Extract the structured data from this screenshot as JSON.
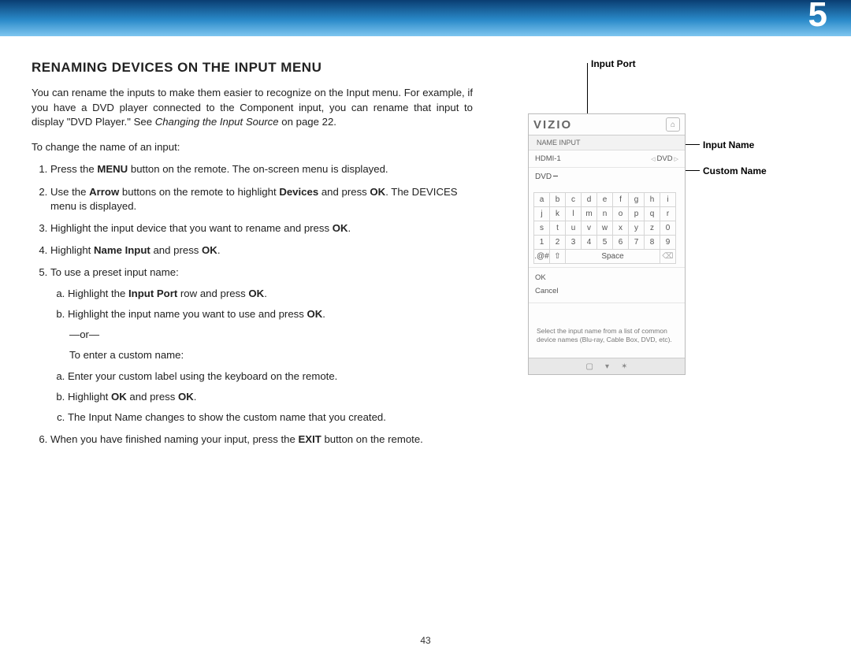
{
  "chapter": "5",
  "page_number": "43",
  "heading": "RENAMING DEVICES ON THE INPUT MENU",
  "intro_html": "You can rename the inputs to make them easier to recognize on the Input menu. For example, if you have a DVD player connected to the Component input, you can rename that input to display \"DVD Player.\" See <i>Changing the Input Source</i> on page 22.",
  "leadin": "To change the name of an input:",
  "steps": [
    "Press the <b>MENU</b> button on the remote. The on-screen menu is displayed.",
    "Use the <b>Arrow</b> buttons on the remote to highlight <b>Devices</b> and press <b>OK</b>. The DEVICES menu is displayed.",
    "Highlight the input device that you want to rename and press <b>OK</b>.",
    "Highlight <b>Name Input</b> and press <b>OK</b>."
  ],
  "step5_lead": "To use a preset input name:",
  "step5a": "Highlight the <b>Input Port</b> row and press <b>OK</b>.",
  "step5b": "Highlight the input name you want to use and press <b>OK</b>.",
  "or_text": "—or—",
  "custom_lead": "To enter a custom name:",
  "custom_a": "Enter your custom label using the keyboard on the remote.",
  "custom_b": "Highlight <b>OK</b> and press <b>OK</b>.",
  "custom_c": "The Input Name changes to show the custom name that you created.",
  "step6": "When you have finished naming your input, press the <b>EXIT</b> button on the remote.",
  "callouts": {
    "input_port": "Input Port",
    "input_name": "Input Name",
    "custom_name": "Custom Name"
  },
  "osd": {
    "logo": "VIZIO",
    "title": "NAME INPUT",
    "port_label": "HDMI-1",
    "port_value": "DVD",
    "custom_value": "DVD",
    "keyboard_rows": [
      [
        "a",
        "b",
        "c",
        "d",
        "e",
        "f",
        "g",
        "h",
        "i"
      ],
      [
        "j",
        "k",
        "l",
        "m",
        "n",
        "o",
        "p",
        "q",
        "r"
      ],
      [
        "s",
        "t",
        "u",
        "v",
        "w",
        "x",
        "y",
        "z",
        "0"
      ],
      [
        "1",
        "2",
        "3",
        "4",
        "5",
        "6",
        "7",
        "8",
        "9"
      ]
    ],
    "sym_key": ".@#",
    "shift_key": "⇧",
    "space_key": "Space",
    "backspace": "⌫",
    "ok": "OK",
    "cancel": "Cancel",
    "hint": "Select the input name from a list of common device names (Blu-ray, Cable Box, DVD, etc).",
    "footer_icons": [
      "▢",
      "▾",
      "✶"
    ]
  }
}
